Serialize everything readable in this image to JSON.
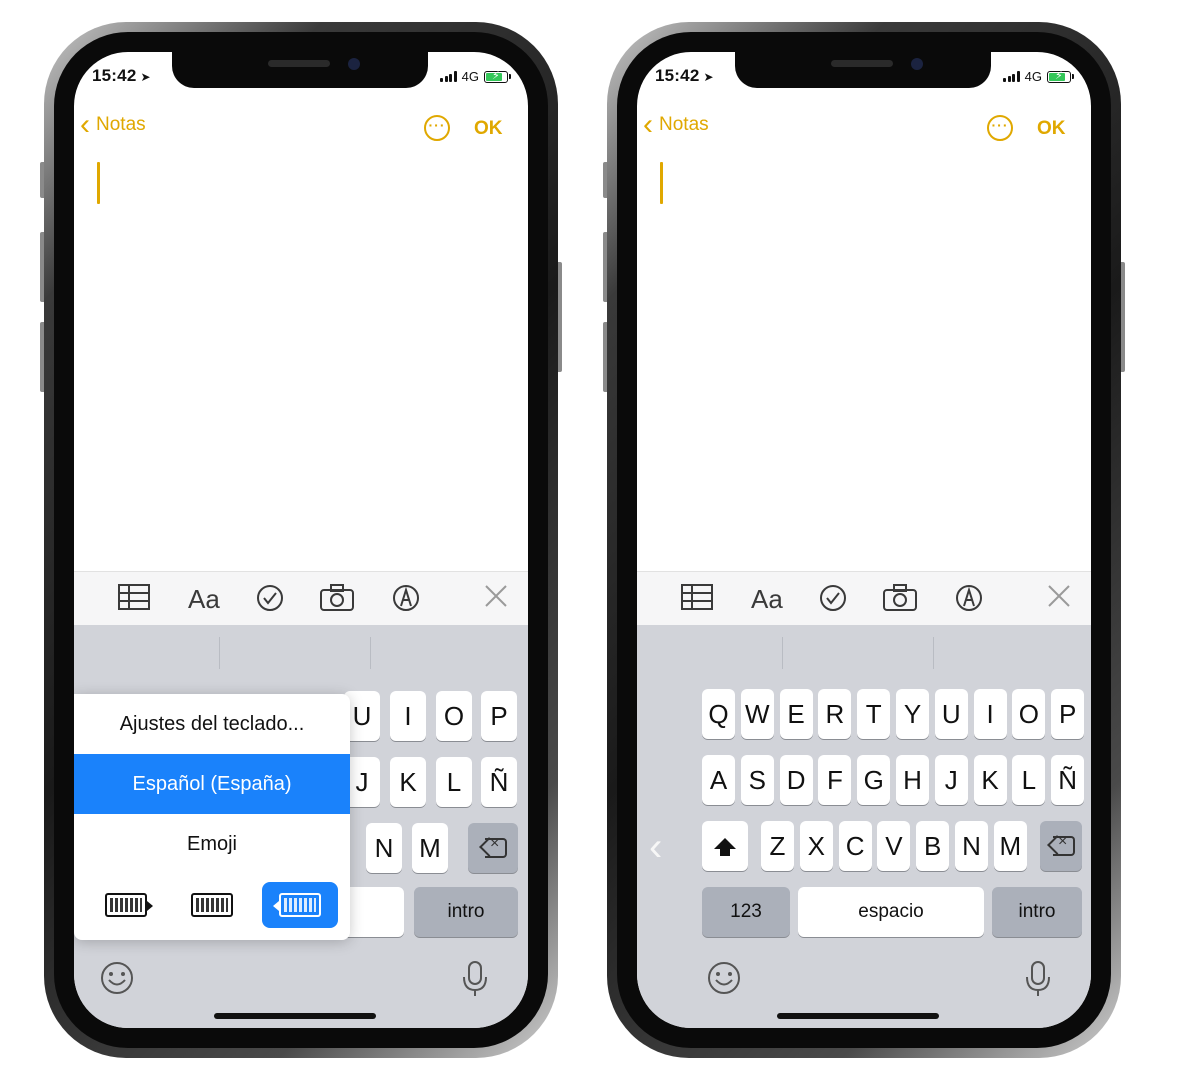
{
  "status": {
    "time": "15:42",
    "network": "4G"
  },
  "nav": {
    "back_label": "Notas",
    "done_label": "OK",
    "more_glyph": "···"
  },
  "toolbar": {
    "icons": [
      "table-icon",
      "format-text-icon",
      "checklist-icon",
      "camera-icon",
      "markup-icon",
      "close-icon"
    ],
    "format_label": "Aa"
  },
  "left_phone": {
    "popup": {
      "settings": "Ajustes del teclado...",
      "language": "Español (España)",
      "emoji": "Emoji"
    },
    "visible_keys": {
      "row1": [
        "U",
        "I",
        "O",
        "P"
      ],
      "row2": [
        "J",
        "K",
        "L",
        "Ñ"
      ],
      "row3": [
        "N",
        "M"
      ],
      "return": "intro"
    }
  },
  "right_phone": {
    "rows": [
      [
        "Q",
        "W",
        "E",
        "R",
        "T",
        "Y",
        "U",
        "I",
        "O",
        "P"
      ],
      [
        "A",
        "S",
        "D",
        "F",
        "G",
        "H",
        "J",
        "K",
        "L",
        "Ñ"
      ],
      [
        "Z",
        "X",
        "C",
        "V",
        "B",
        "N",
        "M"
      ]
    ],
    "numbers": "123",
    "space": "espacio",
    "return": "intro"
  },
  "colors": {
    "accent": "#e0a800",
    "selection": "#1a82fb",
    "keyboard_bg": "#d1d3d9"
  }
}
